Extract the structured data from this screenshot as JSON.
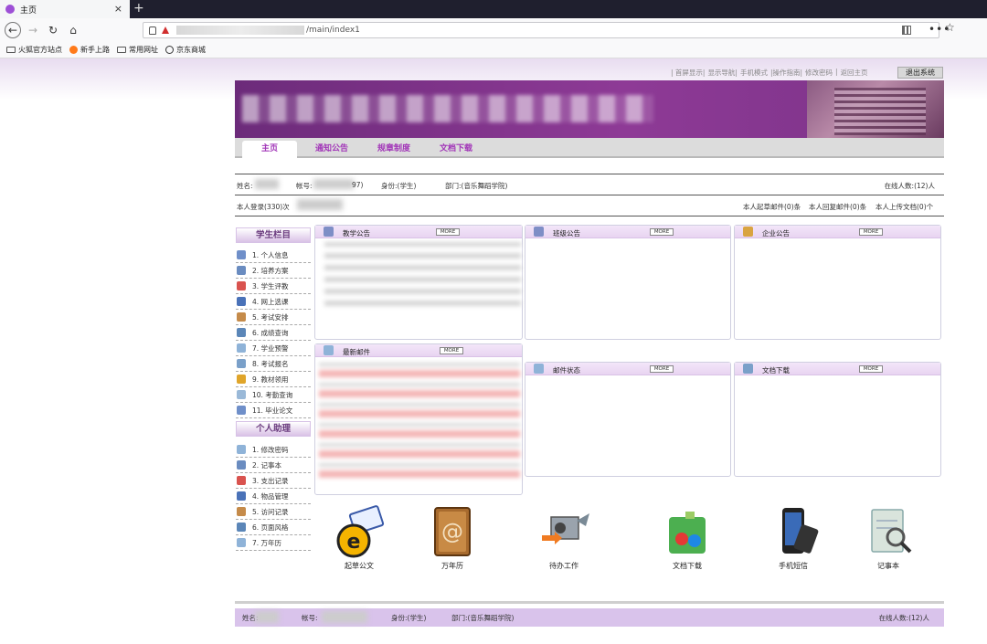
{
  "browser": {
    "tab_title": "主页",
    "tab_close": "×",
    "new_tab": "+",
    "url_suffix": "/main/index1",
    "bookmarks": [
      "火狐官方站点",
      "新手上路",
      "常用网址",
      "京东商城"
    ]
  },
  "colors": {
    "accent": "#a236b8",
    "banner": "#7b3388",
    "footer": "#d9c3eb"
  },
  "top_links": [
    "| 首屏显示|",
    "显示导航|",
    "手机模式",
    "|操作指南|",
    "修改密码",
    "|",
    "返回主页"
  ],
  "logout_label": "退出系统",
  "menu": [
    "主页",
    "通知公告",
    "规章制度",
    "文档下载"
  ],
  "user_info": {
    "name_label": "姓名:",
    "account_label": "帐号:",
    "account_tail": "97)",
    "identity": "身份:(学生)",
    "department": "部门:(音乐舞蹈学院)",
    "online": "在线人数:(12)人",
    "login_count": "本人登录(330)次",
    "mail_draft": "本人起草邮件(0)条",
    "mail_reply": "本人回复邮件(0)条",
    "docs_uploaded": "本人上传文档(0)个"
  },
  "sidebar": {
    "student_heading": "学生栏目",
    "student_items": [
      "1. 个人信息",
      "2. 培养方案",
      "3. 学生评教",
      "4. 网上选课",
      "5. 考试安排",
      "6. 成绩查询",
      "7. 学业预警",
      "8. 考试报名",
      "9. 教材领用",
      "10. 考勤查询",
      "11. 毕业论文"
    ],
    "assistant_heading": "个人助理",
    "assistant_items": [
      "1. 修改密码",
      "2. 记事本",
      "3. 支出记录",
      "4. 物品管理",
      "5. 访问记录",
      "6. 页面风格",
      "7. 万年历"
    ]
  },
  "panels": {
    "teaching_notice": "教学公告",
    "class_notice": "班级公告",
    "company_notice": "企业公告",
    "latest_mail": "最新邮件",
    "mail_status": "邮件状态",
    "doc_download": "文档下载",
    "more_label": "MORE"
  },
  "apps": [
    "起草公文",
    "万年历",
    "待办工作",
    "文档下载",
    "手机短信",
    "记事本"
  ],
  "footer": {
    "name_label": "姓名:",
    "account_label": "帐号:",
    "identity": "身份:(学生)",
    "department": "部门:(音乐舞蹈学院)",
    "online": "在线人数:(12)人"
  }
}
